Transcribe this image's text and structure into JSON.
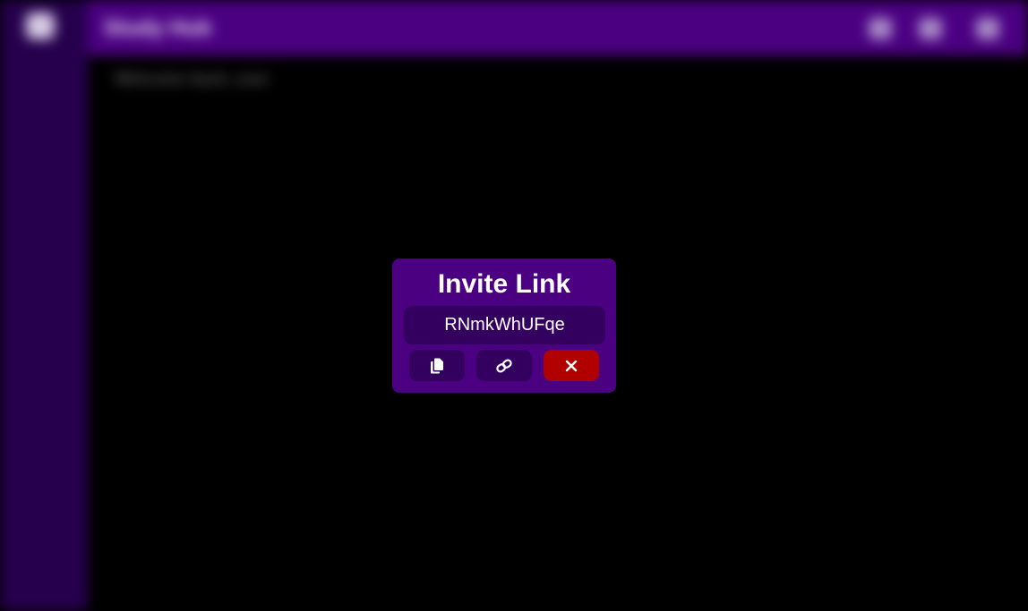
{
  "app": {
    "title": "Study Hub",
    "content_heading": "Welcome back, user"
  },
  "modal": {
    "title": "Invite Link",
    "invite_code": "RNmkWhUFqe",
    "buttons": {
      "copy_icon": "copy-icon",
      "link_icon": "link-icon",
      "close_icon": "close-icon"
    }
  },
  "colors": {
    "modal_bg": "#4b0082",
    "code_bg": "#330060",
    "close_button": "#b00000",
    "topbar": "#4b0082",
    "sidebar": "#26004d"
  }
}
